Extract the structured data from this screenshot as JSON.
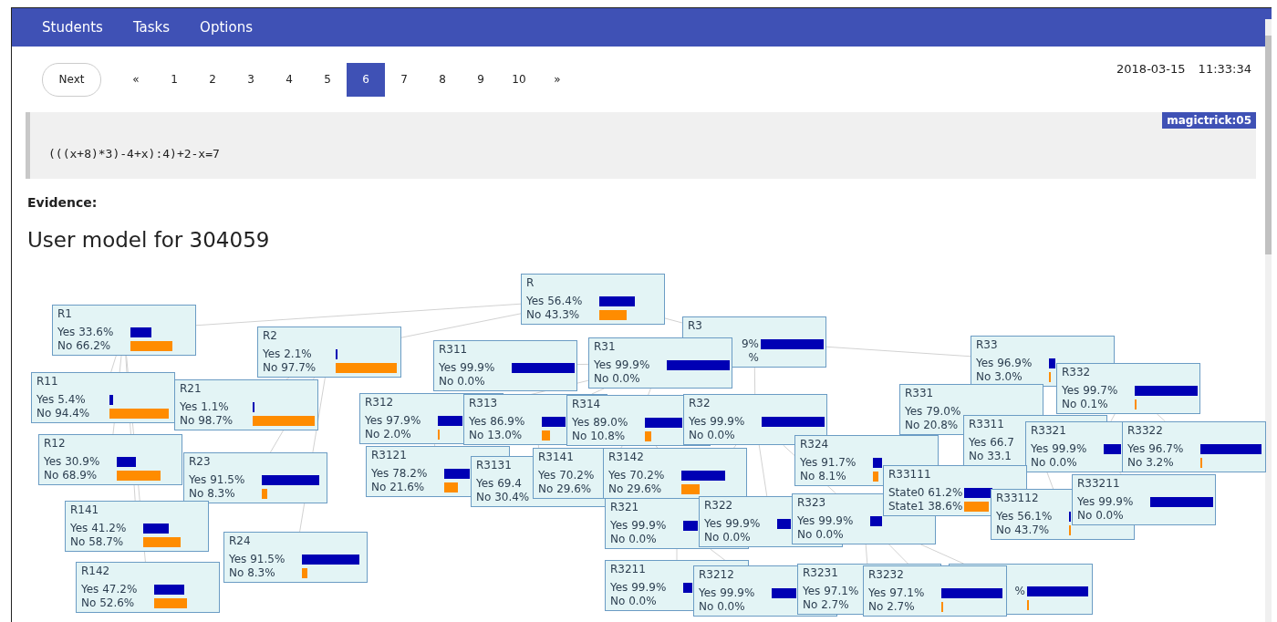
{
  "nav": [
    "Students",
    "Tasks",
    "Options"
  ],
  "next_button": "Next",
  "pages": [
    {
      "label": "«",
      "selected": false
    },
    {
      "label": "1",
      "selected": false
    },
    {
      "label": "2",
      "selected": false
    },
    {
      "label": "3",
      "selected": false
    },
    {
      "label": "4",
      "selected": false
    },
    {
      "label": "5",
      "selected": false
    },
    {
      "label": "6",
      "selected": true
    },
    {
      "label": "7",
      "selected": false
    },
    {
      "label": "8",
      "selected": false
    },
    {
      "label": "9",
      "selected": false
    },
    {
      "label": "10",
      "selected": false
    },
    {
      "label": "»",
      "selected": false
    }
  ],
  "date": "2018-03-15",
  "time": "11:33:34",
  "task": {
    "badge": "magictrick:05",
    "expression": "(((x+8)*3)-4+x):4)+2-x=7"
  },
  "evidence_label": "Evidence:",
  "model_title": "User model for 304059",
  "nodes": [
    {
      "title": "R",
      "rows": [
        {
          "label": "Yes 56.4%"
        },
        {
          "label": "No 43.3%"
        }
      ]
    },
    {
      "title": "R1",
      "rows": [
        {
          "label": "Yes 33.6%"
        },
        {
          "label": "No 66.2%"
        }
      ]
    },
    {
      "title": "R2",
      "rows": [
        {
          "label": "Yes 2.1%"
        },
        {
          "label": "No 97.7%"
        }
      ]
    },
    {
      "title": "R311",
      "rows": [
        {
          "label": "Yes 99.9%"
        },
        {
          "label": "No 0.0%"
        }
      ]
    },
    {
      "title": "R31",
      "rows": [
        {
          "label": "Yes 99.9%"
        },
        {
          "label": "No 0.0%"
        }
      ]
    },
    {
      "title": "R3",
      "rows": [
        {
          "label": "9%",
          "clipped": true
        },
        {
          "label": "%",
          "clipped": true
        }
      ]
    },
    {
      "title": "R33",
      "rows": [
        {
          "label": "Yes 96.9%"
        },
        {
          "label": "No 3.0%"
        }
      ]
    },
    {
      "title": "R11",
      "rows": [
        {
          "label": "Yes 5.4%"
        },
        {
          "label": "No 94.4%"
        }
      ]
    },
    {
      "title": "R21",
      "rows": [
        {
          "label": "Yes 1.1%"
        },
        {
          "label": "No 98.7%"
        }
      ]
    },
    {
      "title": "R312",
      "rows": [
        {
          "label": "Yes 97.9%"
        },
        {
          "label": "No 2.0%"
        }
      ]
    },
    {
      "title": "R313",
      "rows": [
        {
          "label": "Yes 86.9%"
        },
        {
          "label": "No 13.0%"
        }
      ]
    },
    {
      "title": "R314",
      "rows": [
        {
          "label": "Yes 89.0%"
        },
        {
          "label": "No 10.8%"
        }
      ]
    },
    {
      "title": "R32",
      "rows": [
        {
          "label": "Yes 99.9%"
        },
        {
          "label": "No 0.0%"
        }
      ]
    },
    {
      "title": "R331",
      "rows": [
        {
          "label": "Yes 79.0%"
        },
        {
          "label": "No 20.8%"
        }
      ]
    },
    {
      "title": "R332",
      "rows": [
        {
          "label": "Yes 99.7%"
        },
        {
          "label": "No 0.1%"
        }
      ]
    },
    {
      "title": "R12",
      "rows": [
        {
          "label": "Yes 30.9%"
        },
        {
          "label": "No 68.9%"
        }
      ]
    },
    {
      "title": "R23",
      "rows": [
        {
          "label": "Yes 91.5%"
        },
        {
          "label": "No 8.3%"
        }
      ]
    },
    {
      "title": "R3121",
      "rows": [
        {
          "label": "Yes 78.2%"
        },
        {
          "label": "No 21.6%"
        }
      ]
    },
    {
      "title": "R3131",
      "rows": [
        {
          "label": "Yes 69.4"
        },
        {
          "label": "No 30.4%"
        }
      ]
    },
    {
      "title": "R3141",
      "rows": [
        {
          "label": "Yes 70.2%"
        },
        {
          "label": "No 29.6%"
        }
      ]
    },
    {
      "title": "R3142",
      "rows": [
        {
          "label": "Yes 70.2%"
        },
        {
          "label": "No 29.6%"
        }
      ]
    },
    {
      "title": "R324",
      "rows": [
        {
          "label": "Yes 91.7%"
        },
        {
          "label": "No 8.1%"
        }
      ]
    },
    {
      "title": "R33111",
      "rows": [
        {
          "label": "State0 61.2%"
        },
        {
          "label": "State1 38.6%"
        }
      ]
    },
    {
      "title": "R3311",
      "rows": [
        {
          "label": "Yes 66.7"
        },
        {
          "label": "No 33.1"
        }
      ]
    },
    {
      "title": "R3321",
      "rows": [
        {
          "label": "Yes 99.9%"
        },
        {
          "label": "No 0.0%"
        }
      ]
    },
    {
      "title": "R3322",
      "rows": [
        {
          "label": "Yes 96.7%"
        },
        {
          "label": "No 3.2%"
        }
      ]
    },
    {
      "title": "R141",
      "rows": [
        {
          "label": "Yes 41.2%"
        },
        {
          "label": "No 58.7%"
        }
      ]
    },
    {
      "title": "R321",
      "rows": [
        {
          "label": "Yes 99.9%"
        },
        {
          "label": "No 0.0%"
        }
      ]
    },
    {
      "title": "R322",
      "rows": [
        {
          "label": "Yes 99.9%"
        },
        {
          "label": "No 0.0%"
        }
      ]
    },
    {
      "title": "R323",
      "rows": [
        {
          "label": "Yes 99.9%"
        },
        {
          "label": "No 0.0%"
        }
      ]
    },
    {
      "title": "R33112",
      "rows": [
        {
          "label": "Yes 56.1%"
        },
        {
          "label": "No 43.7%"
        }
      ]
    },
    {
      "title": "R33211",
      "rows": [
        {
          "label": "Yes 99.9%"
        },
        {
          "label": "No 0.0%"
        }
      ]
    },
    {
      "title": "R142",
      "rows": [
        {
          "label": "Yes 47.2%"
        },
        {
          "label": "No 52.6%"
        }
      ]
    },
    {
      "title": "R24",
      "rows": [
        {
          "label": "Yes 91.5%"
        },
        {
          "label": "No 8.3%"
        }
      ]
    },
    {
      "title": "R3211",
      "rows": [
        {
          "label": "Yes 99.9%"
        },
        {
          "label": "No 0.0%"
        }
      ]
    },
    {
      "title": "R3212",
      "rows": [
        {
          "label": "Yes 99.9%"
        },
        {
          "label": "No 0.0%"
        }
      ]
    },
    {
      "title": "R3231",
      "rows": [
        {
          "label": "Yes 97.1%"
        },
        {
          "label": "No 2.7%"
        }
      ]
    },
    {
      "title": "R3232",
      "rows": [
        {
          "label": "Yes 97.1%"
        },
        {
          "label": "No 2.7%"
        }
      ]
    },
    {
      "rows": [
        {
          "label": "%",
          "clipped": true
        },
        {}
      ]
    }
  ]
}
